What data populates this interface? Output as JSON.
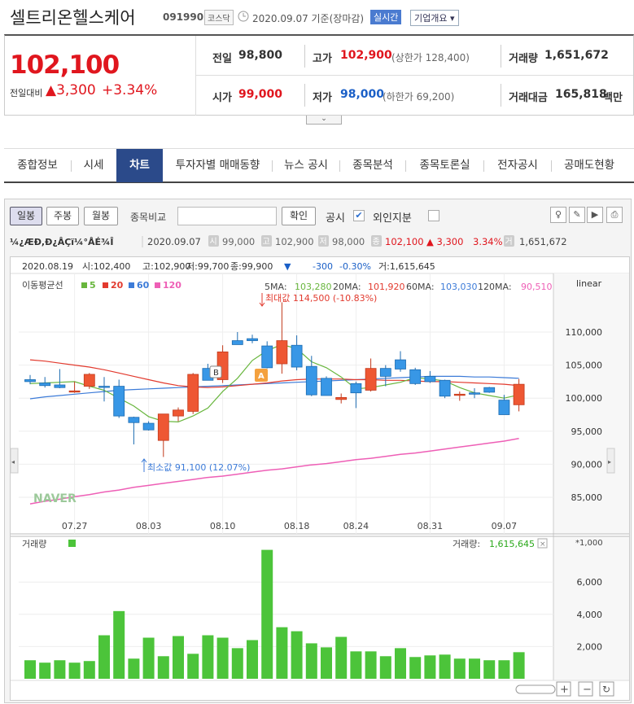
{
  "header": {
    "name": "셀트리온헬스케어",
    "code": "091990",
    "market": "코스닥",
    "date_info": "2020.09.07  기준(장마감)",
    "realtime": "실시간",
    "corp_info": "기업개요 ▾"
  },
  "quote": {
    "price": "102,100",
    "vs_label": "전일대비",
    "change": "▲3,300",
    "change_pct": "+3.34%",
    "prev_label": "전일",
    "prev": "98,800",
    "high_label": "고가",
    "high": "102,900",
    "upper_limit": "(상한가 128,400)",
    "volume_label": "거래량",
    "volume": "1,651,672",
    "open_label": "시가",
    "open": "99,000",
    "low_label": "저가",
    "low": "98,000",
    "lower_limit": "(하한가 69,200)",
    "amount_label": "거래대금",
    "amount": "165,818",
    "amount_unit": "백만"
  },
  "tabs": [
    "종합정보",
    "시세",
    "차트",
    "투자자별 매매동향",
    "뉴스 공시",
    "종목분석",
    "종목토론실",
    "전자공시",
    "공매도현황"
  ],
  "controls": {
    "day": "일봉",
    "week": "주봉",
    "month": "월봉",
    "compare": "종목비교",
    "ok": "확인",
    "disclosure": "공시",
    "foreign": "외인지분",
    "checkmark": "✔"
  },
  "info_row": {
    "garbled": "¼¿ÆÐ,Ð¿ÂÇï¼°ÅÉ¾Î",
    "date": "2020.09.07",
    "open_tag": "시",
    "open": "99,000",
    "high_tag": "고",
    "high": "102,900",
    "low_tag": "저",
    "low": "98,000",
    "close_tag": "종",
    "close": "102,100",
    "chg": "▲ 3,300",
    "pct": "3.34%",
    "vol_tag": "거",
    "vol": "1,651,672"
  },
  "chart_data": {
    "type": "candlestick",
    "hover": {
      "date": "2020.08.19",
      "open": "시:102,400",
      "high": "고:102,900",
      "low": "저:99,700",
      "close": "종:99,900",
      "arrow": "▼",
      "chg": "-300",
      "pct": "-0.30%",
      "vol": "거:1,615,645"
    },
    "ma_legend": {
      "title": "이동평균선",
      "ma5": "5",
      "ma20": "20",
      "ma60": "60",
      "ma120": "120"
    },
    "ma_values": {
      "ma5_label": "5MA:",
      "ma5": "103,280",
      "ma20_label": "20MA:",
      "ma20": "101,920",
      "ma60_label": "60MA:",
      "ma60": "103,030",
      "ma120_label": "120MA:",
      "ma120": "90,510"
    },
    "scale": "linear",
    "y_ticks": [
      "110,000",
      "105,000",
      "100,000",
      "95,000",
      "90,000",
      "85,000"
    ],
    "y_tick_values": [
      110000,
      105000,
      100000,
      95000,
      90000,
      85000
    ],
    "x_ticks": [
      "07.27",
      "08.03",
      "08.10",
      "08.18",
      "08.24",
      "08.31",
      "09.07"
    ],
    "x_tick_index": [
      3,
      8,
      13,
      18,
      22,
      27,
      32
    ],
    "max_label": "최대값 114,500 (-10.83%)",
    "min_label": "최소값 91,100 (12.07%)",
    "marker_a": "A",
    "marker_b": "B",
    "watermark": "NAVER",
    "candles": [
      [
        102800,
        103500,
        102100,
        102500
      ],
      [
        102300,
        103200,
        101600,
        101900
      ],
      [
        102000,
        104400,
        101500,
        101600
      ],
      [
        101000,
        102500,
        100800,
        101100
      ],
      [
        101800,
        103800,
        101400,
        103600
      ],
      [
        101800,
        103200,
        99500,
        101700
      ],
      [
        101800,
        102800,
        97000,
        97300
      ],
      [
        97100,
        97200,
        93000,
        96300
      ],
      [
        96200,
        96500,
        95100,
        95200
      ],
      [
        93600,
        97600,
        91100,
        97600
      ],
      [
        97300,
        98600,
        96500,
        98200
      ],
      [
        98000,
        103800,
        97600,
        103600
      ],
      [
        104500,
        105200,
        102900,
        102700
      ],
      [
        102800,
        108000,
        102300,
        107000
      ],
      [
        108700,
        110000,
        108300,
        108100
      ],
      [
        109000,
        109600,
        108300,
        108700
      ],
      [
        107900,
        108600,
        104500,
        104600
      ],
      [
        105200,
        114500,
        103700,
        108700
      ],
      [
        108000,
        109500,
        104200,
        104700
      ],
      [
        104800,
        106400,
        100300,
        100500
      ],
      [
        103000,
        103300,
        100400,
        100400
      ],
      [
        99800,
        100700,
        99200,
        100100
      ],
      [
        102200,
        102500,
        98500,
        100800
      ],
      [
        101200,
        106000,
        101000,
        104500
      ],
      [
        104500,
        105000,
        101800,
        103300
      ],
      [
        105800,
        107100,
        104000,
        104400
      ],
      [
        104300,
        104600,
        102000,
        102200
      ],
      [
        103300,
        104100,
        102300,
        102500
      ],
      [
        102700,
        102800,
        100000,
        100300
      ],
      [
        100600,
        101000,
        99600,
        100600
      ],
      [
        100800,
        101500,
        100000,
        100600
      ],
      [
        101600,
        101700,
        100800,
        100900
      ],
      [
        99700,
        100500,
        97500,
        97500
      ],
      [
        99000,
        102900,
        98000,
        102100
      ]
    ],
    "ma5": [
      102200,
      102300,
      102400,
      102500,
      101800,
      101200,
      100000,
      98800,
      97200,
      96500,
      96400,
      97300,
      98500,
      101000,
      103000,
      105700,
      107200,
      108100,
      107500,
      105500,
      104600,
      103200,
      101400,
      101600,
      102000,
      102400,
      103100,
      102900,
      102600,
      101600,
      100800,
      100400,
      100000,
      100500
    ],
    "ma20": [
      105800,
      105600,
      105300,
      105000,
      104700,
      104300,
      103800,
      103300,
      102800,
      102300,
      101900,
      101700,
      101600,
      101700,
      101900,
      102100,
      102300,
      102600,
      102800,
      102900,
      102900,
      102900,
      102800,
      102800,
      102700,
      102700,
      102600,
      102500,
      102500,
      102400,
      102300,
      102200,
      102100,
      101900
    ],
    "ma60": [
      99900,
      100200,
      100400,
      100600,
      100800,
      101000,
      101200,
      101300,
      101400,
      101500,
      101600,
      101700,
      101800,
      101900,
      102000,
      102100,
      102200,
      102300,
      102400,
      102500,
      102600,
      102700,
      102800,
      102900,
      103000,
      103100,
      103200,
      103300,
      103300,
      103300,
      103200,
      103200,
      103100,
      103000
    ],
    "ma120": [
      84000,
      84400,
      84700,
      85100,
      85400,
      85800,
      86100,
      86500,
      86800,
      87100,
      87400,
      87700,
      88000,
      88200,
      88500,
      88800,
      89100,
      89300,
      89600,
      89900,
      90100,
      90400,
      90700,
      90900,
      91200,
      91500,
      91700,
      92000,
      92300,
      92600,
      92900,
      93200,
      93500,
      93900
    ],
    "volume": {
      "label": "거래량",
      "current_label": "거래량:",
      "current": "1,615,645",
      "unit": "*1,000",
      "y_ticks": [
        "6,000",
        "4,000",
        "2,000"
      ],
      "y_tick_values": [
        6000,
        4000,
        2000
      ],
      "values": [
        1150,
        1000,
        1150,
        1000,
        1100,
        2700,
        4200,
        1250,
        2550,
        1400,
        2650,
        1550,
        2700,
        2550,
        1900,
        2400,
        8000,
        3200,
        2950,
        2200,
        1950,
        2600,
        1700,
        1700,
        1400,
        1900,
        1350,
        1450,
        1500,
        1250,
        1250,
        1150,
        1150,
        1650
      ]
    }
  }
}
